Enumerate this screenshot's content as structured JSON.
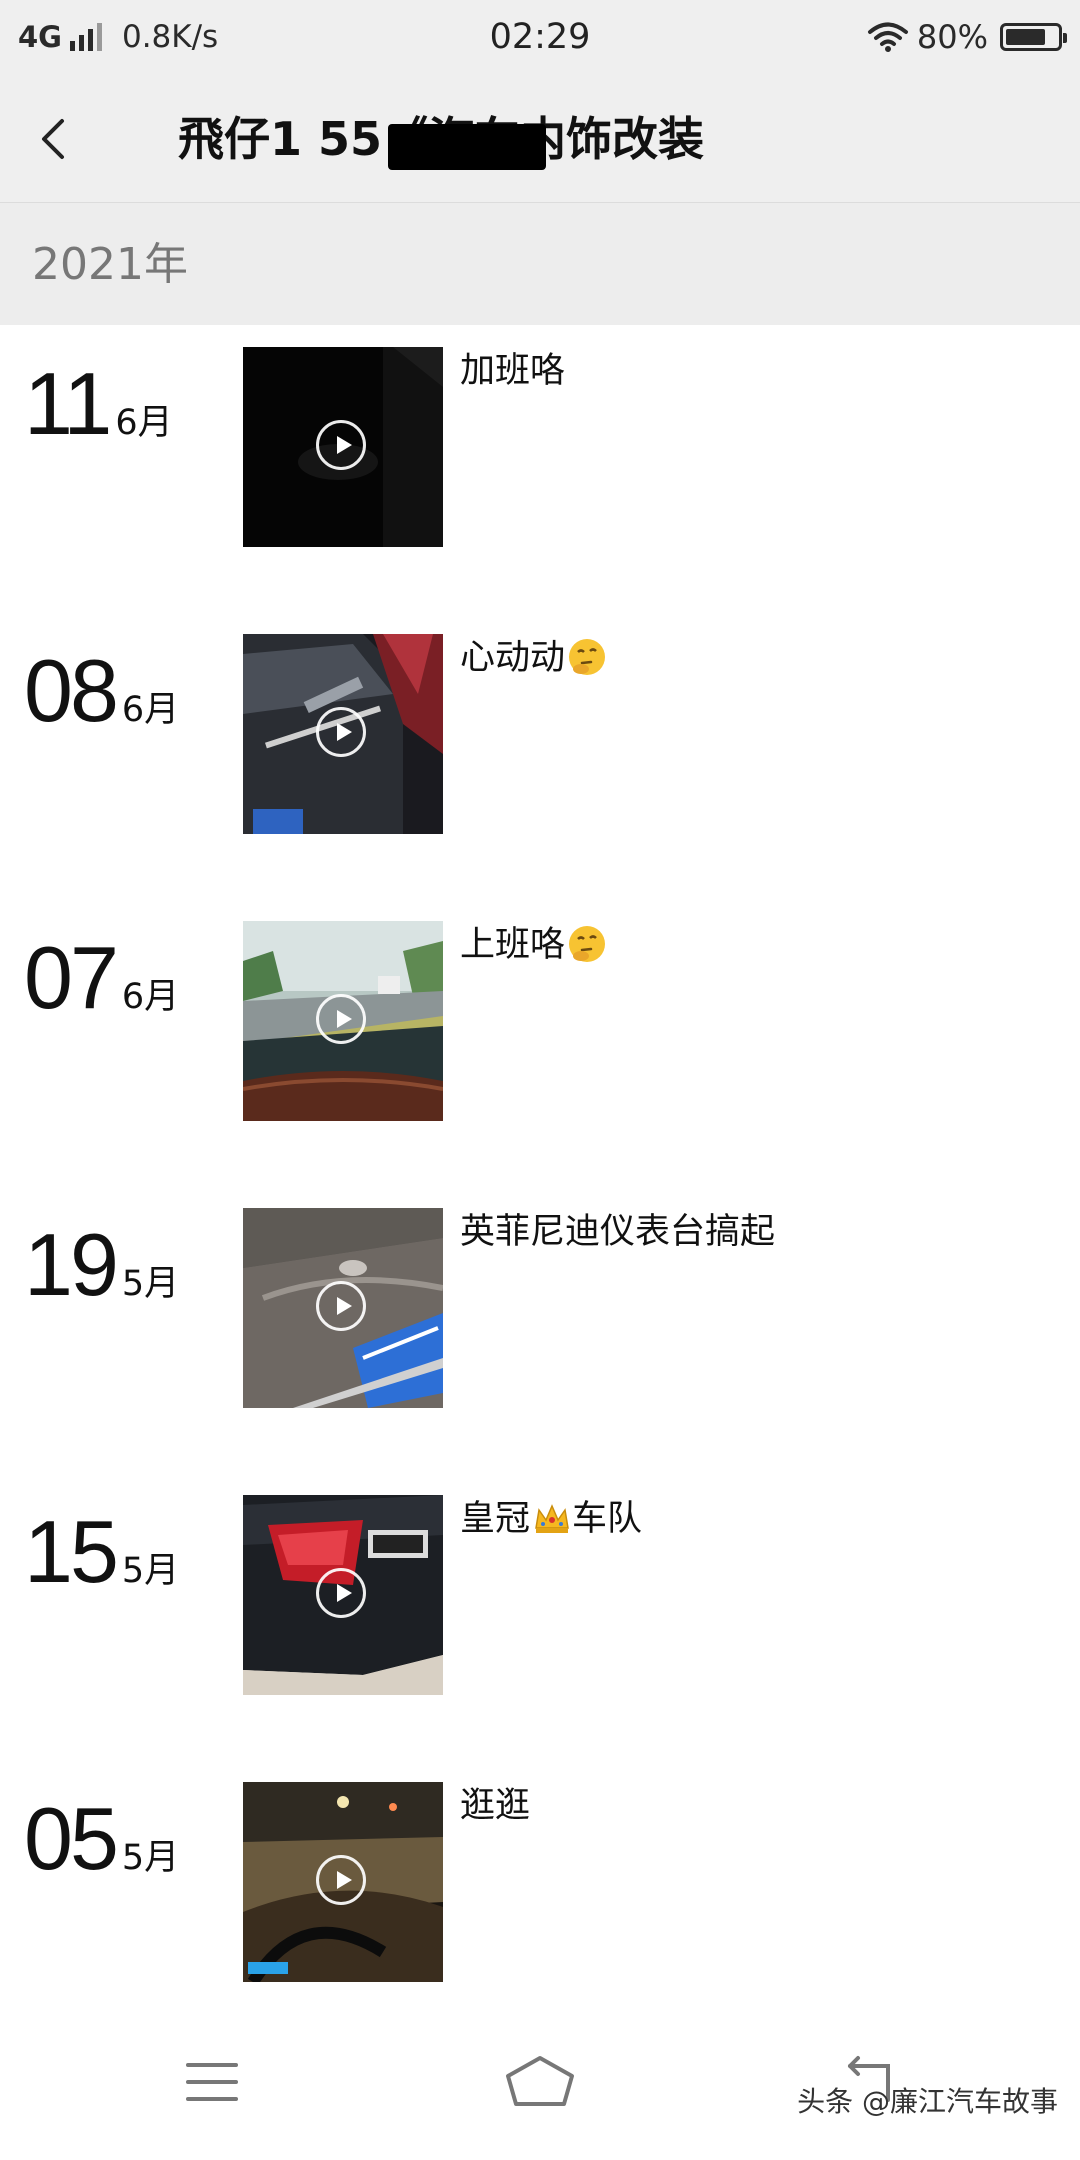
{
  "status_bar": {
    "network": "4G",
    "speed": "0.8K/s",
    "time": "02:29",
    "battery": "80%",
    "battery_level": 0.8
  },
  "header": {
    "title": "飛仔1 55《汽车内饰改装"
  },
  "year_label": "2021年",
  "posts": [
    {
      "day": "11",
      "month": "6月",
      "caption": "加班咯",
      "emoji": ""
    },
    {
      "day": "08",
      "month": "6月",
      "caption": "心动动",
      "emoji": "thinking-face"
    },
    {
      "day": "07",
      "month": "6月",
      "caption": "上班咯",
      "emoji": "thinking-face"
    },
    {
      "day": "19",
      "month": "5月",
      "caption": "英菲尼迪仪表台搞起",
      "emoji": ""
    },
    {
      "day": "15",
      "month": "5月",
      "caption": "皇冠",
      "emoji": "crown",
      "caption_after": "车队"
    },
    {
      "day": "05",
      "month": "5月",
      "caption": "逛逛",
      "emoji": ""
    }
  ],
  "watermark": "头条 @廉江汽车故事",
  "icons": [
    "back-arrow-icon",
    "play-icon",
    "thinking-face-emoji",
    "crown-emoji",
    "menu-icon",
    "home-icon",
    "return-icon",
    "wifi-icon",
    "battery-icon",
    "signal-icon"
  ]
}
